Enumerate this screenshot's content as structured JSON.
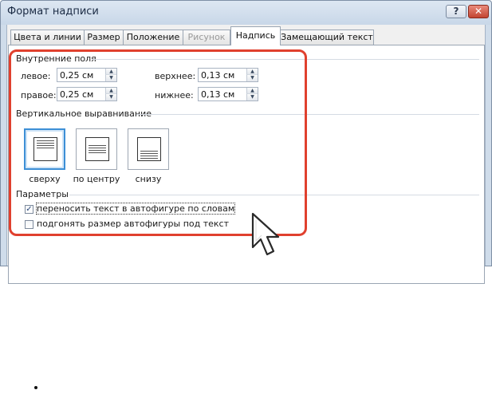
{
  "window": {
    "title": "Формат надписи",
    "help_label": "?",
    "close_label": "✕"
  },
  "tabs": [
    {
      "label": "Цвета и линии",
      "state": "normal"
    },
    {
      "label": "Размер",
      "state": "normal"
    },
    {
      "label": "Положение",
      "state": "normal"
    },
    {
      "label": "Рисунок",
      "state": "disabled"
    },
    {
      "label": "Надпись",
      "state": "active"
    },
    {
      "label": "Замещающий текст",
      "state": "normal"
    }
  ],
  "inner_margins": {
    "title": "Внутренние поля",
    "left": {
      "label": "левое:",
      "value": "0,25 см"
    },
    "right": {
      "label": "правое:",
      "value": "0,25 см"
    },
    "top": {
      "label": "верхнее:",
      "value": "0,13 см"
    },
    "bottom": {
      "label": "нижнее:",
      "value": "0,13 см"
    }
  },
  "vertical_alignment": {
    "title": "Вертикальное выравнивание",
    "options": [
      {
        "label": "сверху",
        "selected": true
      },
      {
        "label": "по центру",
        "selected": false
      },
      {
        "label": "снизу",
        "selected": false
      }
    ]
  },
  "parameters": {
    "title": "Параметры",
    "word_wrap": {
      "label": "переносить текст в автофигуре по словам",
      "checked": true
    },
    "resize_to_fit": {
      "label": "подгонять размер автофигуры под текст",
      "checked": false
    }
  },
  "glyphs": {
    "check": "✓",
    "arrow_up": "▲",
    "arrow_down": "▼"
  },
  "colors": {
    "highlight": "#e0402e",
    "selected_border": "#3d8fd6"
  },
  "icons": {
    "cursor": "arrow-cursor-icon",
    "bullet": "bullet-icon"
  }
}
